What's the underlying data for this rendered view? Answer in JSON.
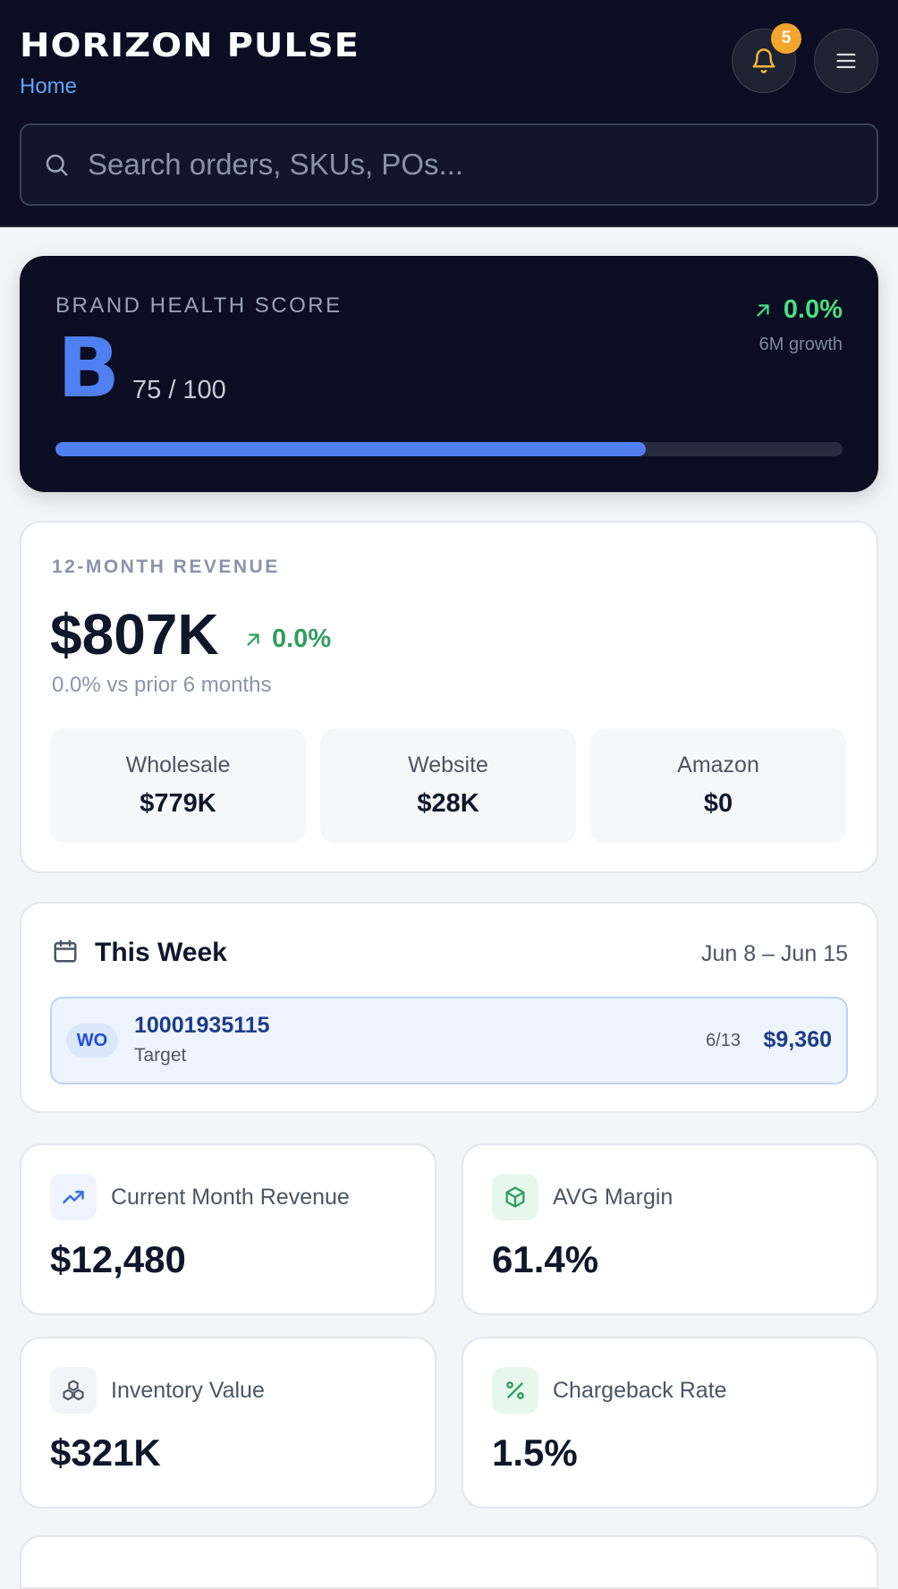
{
  "header": {
    "brand": "HORIZON PULSE",
    "breadcrumb": "Home",
    "notifications_count": "5",
    "search_placeholder": "Search orders, SKUs, POs..."
  },
  "health": {
    "label": "BRAND HEALTH SCORE",
    "grade": "B",
    "score_text": "75 / 100",
    "score_fraction": 0.75,
    "growth": "0.0%",
    "growth_label": "6M growth"
  },
  "revenue": {
    "label": "12-MONTH REVENUE",
    "amount": "$807K",
    "delta": "0.0%",
    "subtitle": "0.0% vs prior 6 months",
    "channels": [
      {
        "name": "Wholesale",
        "value": "$779K"
      },
      {
        "name": "Website",
        "value": "$28K"
      },
      {
        "name": "Amazon",
        "value": "$0"
      }
    ]
  },
  "week": {
    "title": "This Week",
    "range": "Jun 8 – Jun 15",
    "orders": [
      {
        "tag": "WO",
        "number": "10001935115",
        "customer": "Target",
        "date": "6/13",
        "amount": "$9,360"
      }
    ]
  },
  "metrics": [
    {
      "label": "Current Month Revenue",
      "value": "$12,480",
      "icon": "trending-up-icon"
    },
    {
      "label": "AVG Margin",
      "value": "61.4%",
      "icon": "box-icon"
    },
    {
      "label": "Inventory Value",
      "value": "$321K",
      "icon": "boxes-icon"
    },
    {
      "label": "Chargeback Rate",
      "value": "1.5%",
      "icon": "percent-icon"
    }
  ],
  "colors": {
    "header_bg": "#0b0e22",
    "accent_blue": "#4f7ff0",
    "growth_green": "#4ade80",
    "badge_orange": "#f4a52c",
    "link_blue": "#60a5fa"
  }
}
